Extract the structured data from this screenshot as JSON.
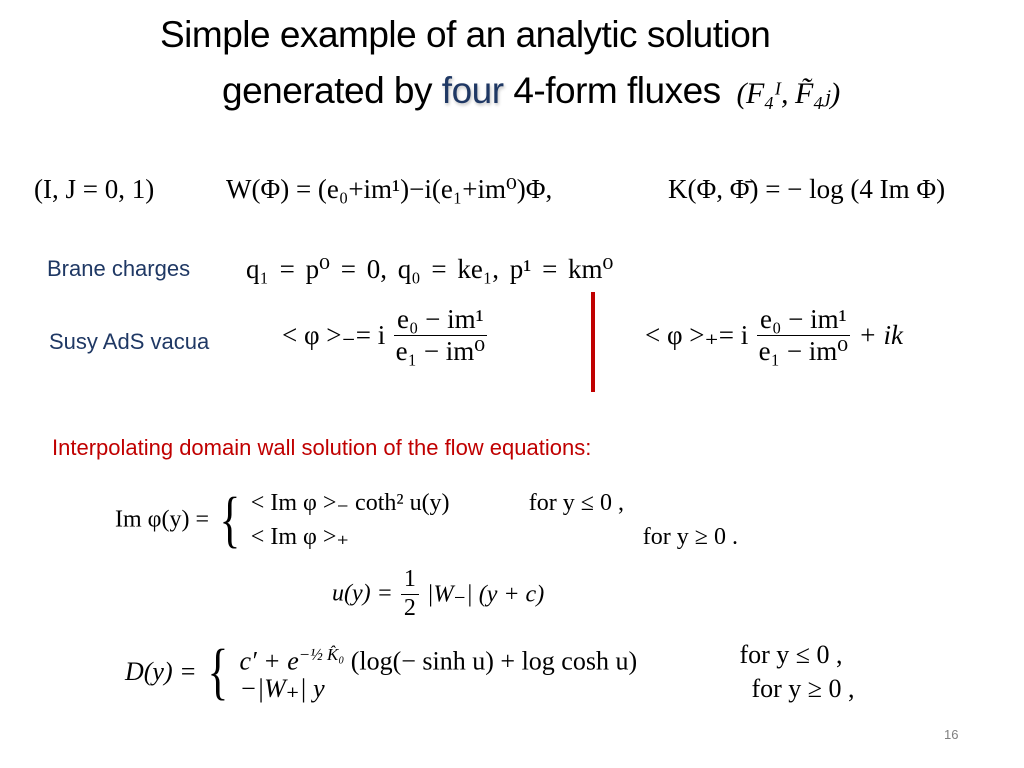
{
  "slide": {
    "title_line1": "Simple example of an analytic solution",
    "title_line2_pre": "generated by ",
    "title_line2_em": "four",
    "title_line2_post": " 4-form fluxes",
    "title_math": "(F₄ᴵ, F̃₄ⱼ)",
    "page_number": "16"
  },
  "equations": {
    "index_range": "(I, J = 0, 1)",
    "superpotential": "W(Φ) = (e₀+im¹)−i(e₁+im⁰)Φ,",
    "kahler": "K(Φ, Φ̄) = − log (4 Im Φ)"
  },
  "brane_charges": {
    "label": "Brane charges",
    "formula": "q₁ = p⁰ = 0,    q₀ = ke₁,    p¹ = km⁰"
  },
  "susy_vacua": {
    "label": "Susy AdS vacua",
    "minus_lhs": "< φ >₋= i",
    "minus_num": "e₀ − im¹",
    "minus_den": "e₁ − im⁰",
    "plus_lhs": "< φ >₊= i",
    "plus_num": "e₀ − im¹",
    "plus_den": "e₁ − im⁰",
    "plus_tail": "+ ik"
  },
  "domain_wall": {
    "heading": "Interpolating domain wall solution of the flow equations:",
    "imphi_lhs": "Im φ(y) =",
    "imphi_case1": "< Im φ >₋ coth² u(y)",
    "imphi_cond1": "for y ≤ 0 ,",
    "imphi_case2": "< Im φ >₊",
    "imphi_cond2": "for y ≥ 0 .",
    "u_lhs": "u(y) =",
    "u_frac_num": "1",
    "u_frac_den": "2",
    "u_rhs": "|W₋| (y + c)",
    "d_lhs": "D(y) =",
    "d_case1_pre": "c′ + e",
    "d_case1_exp": "−½ K̂₀",
    "d_case1_post": " (log(− sinh u) + log cosh u)",
    "d_cond1": "for y ≤ 0 ,",
    "d_case2": "−|W₊| y",
    "d_cond2": "for y ≥ 0 ,"
  }
}
